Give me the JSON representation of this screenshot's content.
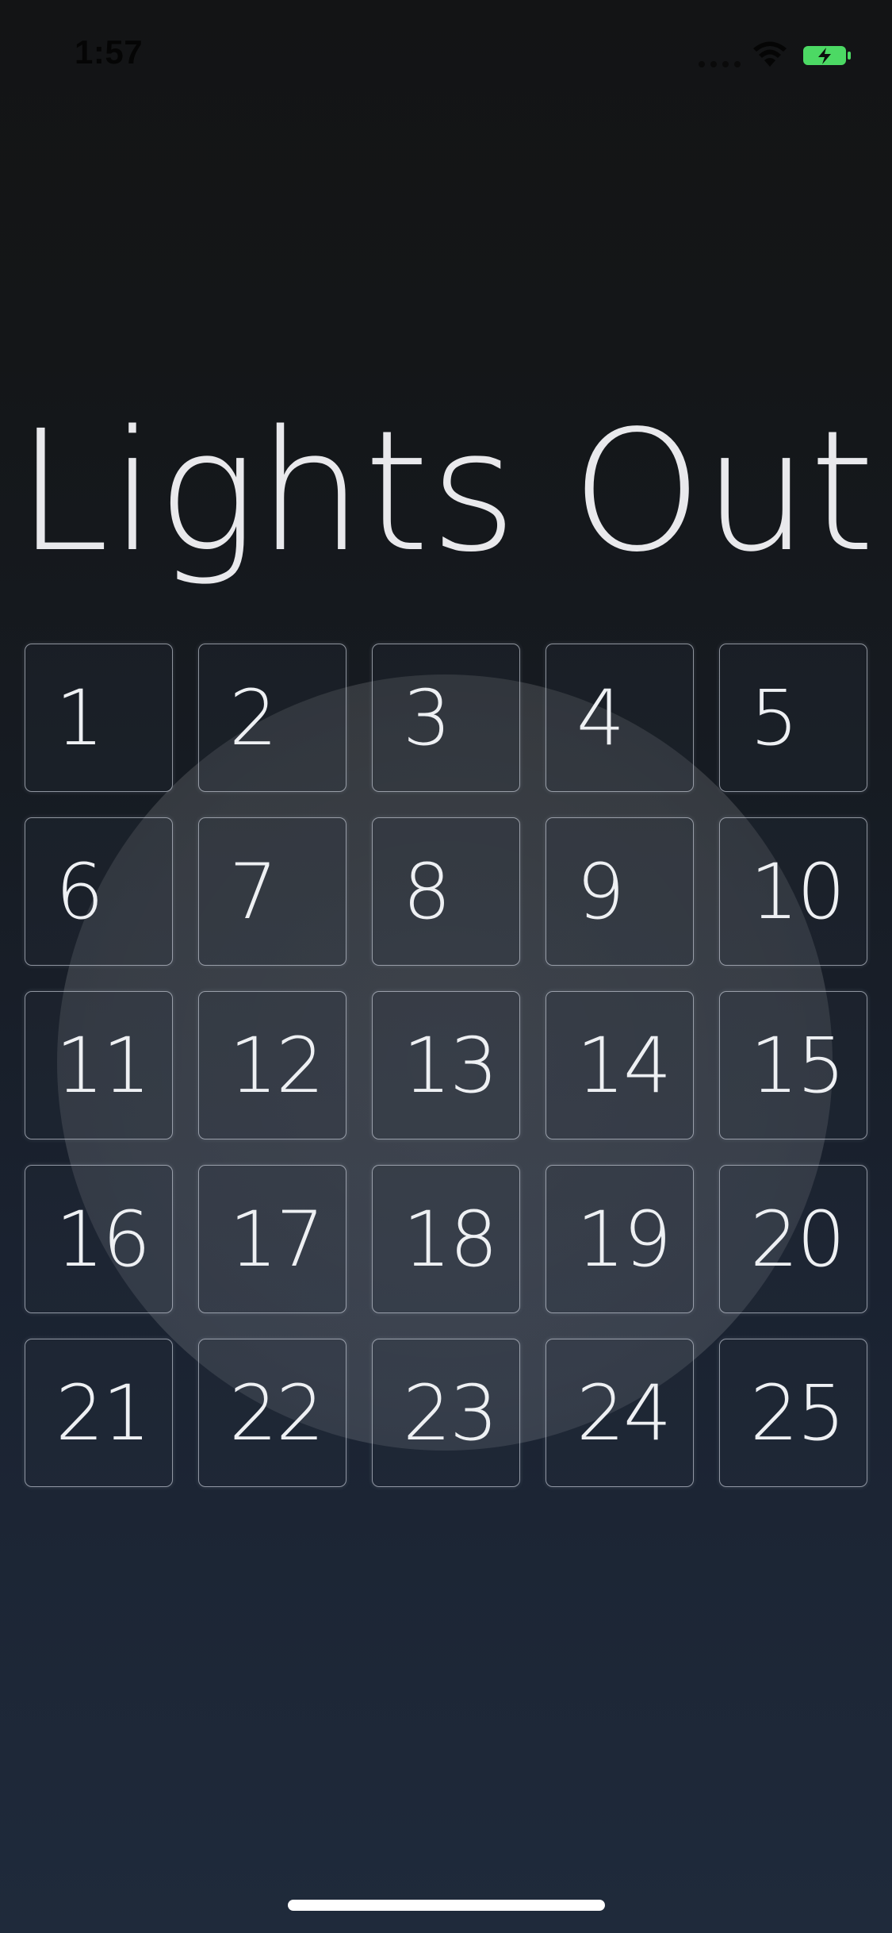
{
  "status_bar": {
    "time": "1:57",
    "icons": [
      "signal-icon",
      "wifi-icon",
      "battery-charging-icon"
    ],
    "battery_color": "#4cd964"
  },
  "title": "Lights Out",
  "board": {
    "rows": 5,
    "columns": 5,
    "cells": [
      "1",
      "2",
      "3",
      "4",
      "5",
      "6",
      "7",
      "8",
      "9",
      "10",
      "11",
      "12",
      "13",
      "14",
      "15",
      "16",
      "17",
      "18",
      "19",
      "20",
      "21",
      "22",
      "23",
      "24",
      "25"
    ]
  },
  "colors": {
    "background_top": "#131415",
    "background_bottom": "#1f2a3b",
    "text": "#eef0f3",
    "cell_border": "#d7dce6"
  }
}
